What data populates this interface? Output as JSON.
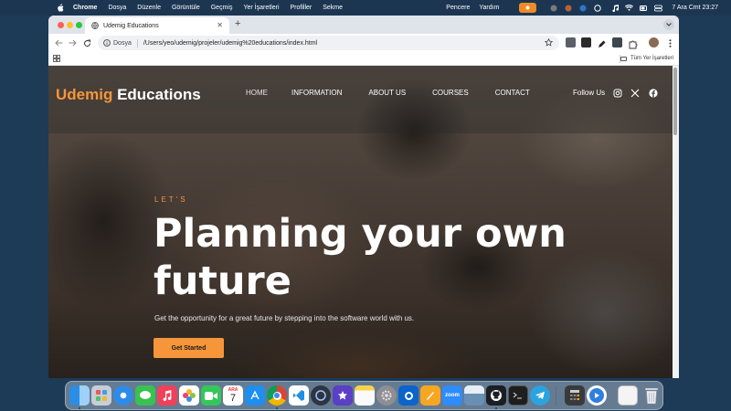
{
  "menubar": {
    "app_name": "Chrome",
    "menus": [
      "Dosya",
      "Düzenle",
      "Görüntüle",
      "Geçmiş",
      "Yer İşaretleri",
      "Profiller",
      "Sekme"
    ],
    "right_menus": [
      "Pencere",
      "Yardım"
    ],
    "datetime": "7 Ara Cmt  23:27",
    "icons": [
      "apple-icon",
      "recording-icon",
      "wifi-icon",
      "control-center-icon",
      "search-icon",
      "siri-icon"
    ]
  },
  "browser": {
    "tab_title": "Udemig Educations",
    "new_tab": "+",
    "site_label": "Dosya",
    "url": "/Users/yeo/udemig/projeler/udemig%20educations/index.html",
    "bookmarks_all": "Tüm Yer İşaretleri"
  },
  "site": {
    "logo_brand": "Udemig",
    "logo_rest": " Educations",
    "nav": [
      "HOME",
      "INFORMATION",
      "ABOUT US",
      "COURSES",
      "CONTACT"
    ],
    "follow": "Follow Us",
    "social_icons": [
      "instagram-icon",
      "x-twitter-icon",
      "facebook-icon"
    ],
    "hero": {
      "kicker": "LET'S",
      "title": "Planning your own future",
      "subtitle": "Get the opportunity for a great future by stepping into the software world with us.",
      "cta": "Get Started"
    },
    "colors": {
      "accent": "#f5963a",
      "text": "#ffffff"
    }
  },
  "dock": {
    "apps": [
      "Finder",
      "Launchpad",
      "Safari",
      "Messages",
      "Music",
      "Photos",
      "FaceTime",
      "Calendar",
      "App Store",
      "Chrome",
      "VS Code",
      "Proxyman",
      "iMovie",
      "Notes",
      "System Settings",
      "Outlook",
      "Pages",
      "Zoom",
      "Preview",
      "GitHub Desktop",
      "Terminal",
      "Telegram",
      "Calculator",
      "QuickTime",
      "Screenshot",
      "Trash"
    ],
    "calendar_month": "ARA",
    "calendar_day": "7",
    "zoom_label": "zoom"
  }
}
